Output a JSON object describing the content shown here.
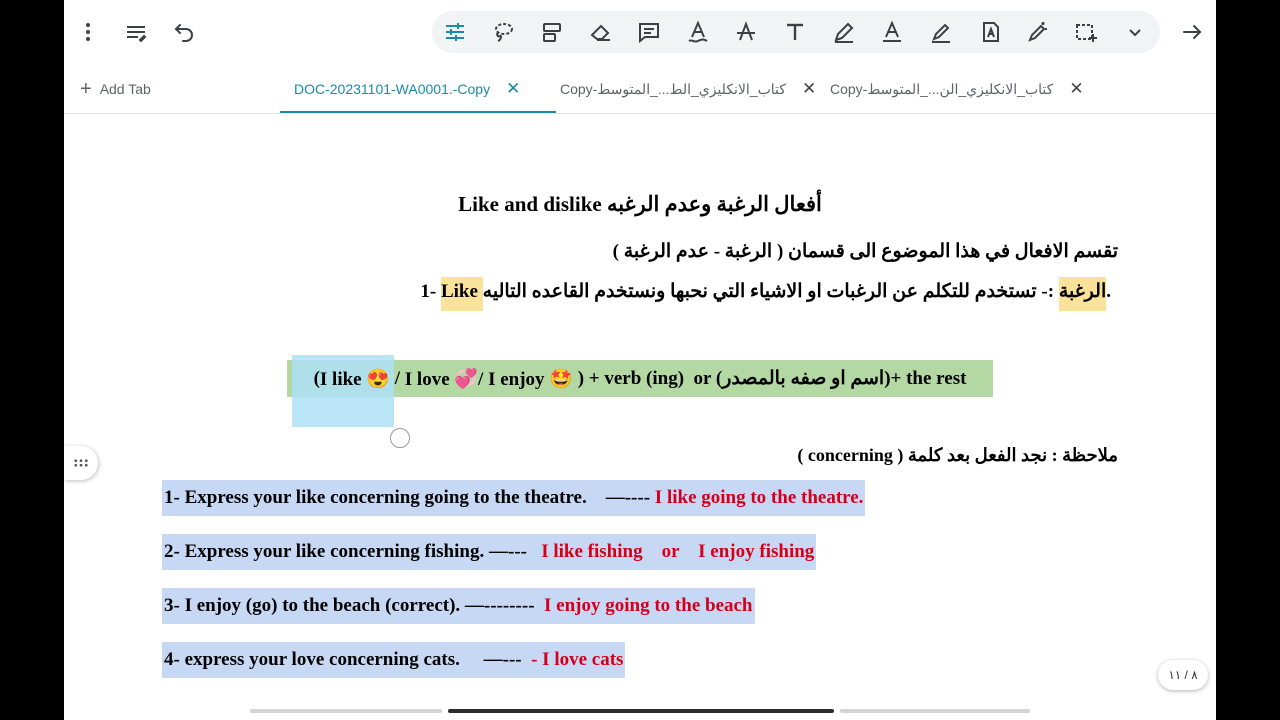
{
  "toolbar": {
    "left": [
      "more-vert-icon",
      "pen-settings-icon",
      "undo-icon"
    ],
    "tools": [
      "sliders-icon",
      "lasso-icon",
      "shapes-icon",
      "eraser-icon",
      "comment-icon",
      "text-underline-icon",
      "strikethrough-icon",
      "text-icon",
      "pen-icon",
      "text-color-icon",
      "highlighter-icon",
      "text-box-icon",
      "magic-pen-icon",
      "selection-icon",
      "chevron-down-icon"
    ],
    "right": "forward-arrow-icon"
  },
  "tabs": {
    "add_label": "Add Tab",
    "items": [
      {
        "label": "DOC-20231101-WA0001.-Copy",
        "active": true
      },
      {
        "label": "Copy-كتاب_الانكليزي_الط..._المتوسط",
        "active": false
      },
      {
        "label": "Copy-كتاب_الانكليزي_الن..._المتوسط",
        "active": false
      }
    ],
    "close_glyph": "✕",
    "accent_color": "#1b8aa6"
  },
  "doc": {
    "title": "أفعال الرغبة وعدم الرغبه Like and dislike",
    "intro": "تقسم الافعال في هذا الموضوع الى قسمان ( الرغبة - عدم الرغبة )",
    "point1": {
      "number": "1-",
      "highlight": "Like الرغبة",
      "text": ":- تستخدم للتكلم عن الرغبات او الاشياء التي نحبها ونستخدم القاعده التاليه."
    },
    "rule": {
      "open": "(",
      "like": "I like 😍",
      "sep1": " / ",
      "love": "I love 💞/",
      "enjoy": " I enjoy 🤩 ",
      "close": ")",
      "rest": " + verb (ing)  or (اسم او صفه بالمصدر)+ the rest"
    },
    "note": "ملاحظة : نجد الفعل بعد كلمة ( concerning )",
    "examples": [
      {
        "q": "1- Express your like concerning going to the theatre.    —---- ",
        "a": "I like going to the theatre."
      },
      {
        "q": "2- Express your like concerning fishing. —---   ",
        "a": "I like fishing    or    I enjoy fishing"
      },
      {
        "q": "3- I enjoy (go) to the beach (correct). —--------  ",
        "a": "I enjoy going to the beach"
      },
      {
        "q": "4- express your love concerning cats.     —---  ",
        "a": "- I love cats"
      }
    ]
  },
  "page_indicator": "٨ / ١١",
  "colors": {
    "highlight_blue": "#c7d8f4",
    "highlight_green": "#b3d8a3",
    "highlight_yellow": "#fbe29a",
    "answer_red": "#d3001a",
    "selection": "#aee0f5"
  }
}
